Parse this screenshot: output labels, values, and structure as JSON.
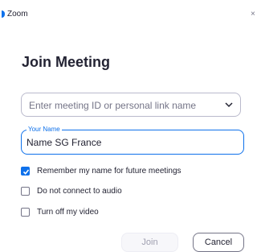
{
  "titlebar": {
    "app_name": "Zoom",
    "close_glyph": "×",
    "icons": [
      "zoom-logo-icon",
      "close-icon"
    ]
  },
  "heading": "Join Meeting",
  "meeting_id": {
    "placeholder": "Enter meeting ID or personal link name",
    "icon": "chevron-down-icon"
  },
  "name_field": {
    "label": "Your Name",
    "value": "Name SG France"
  },
  "options": [
    {
      "label": "Remember my name for future meetings",
      "checked": true
    },
    {
      "label": "Do not connect to audio",
      "checked": false
    },
    {
      "label": "Turn off my video",
      "checked": false
    }
  ],
  "buttons": {
    "join": "Join",
    "cancel": "Cancel"
  },
  "colors": {
    "accent": "#0e71eb",
    "highlight": "#ffff00",
    "text": "#232333",
    "muted": "#747487"
  }
}
